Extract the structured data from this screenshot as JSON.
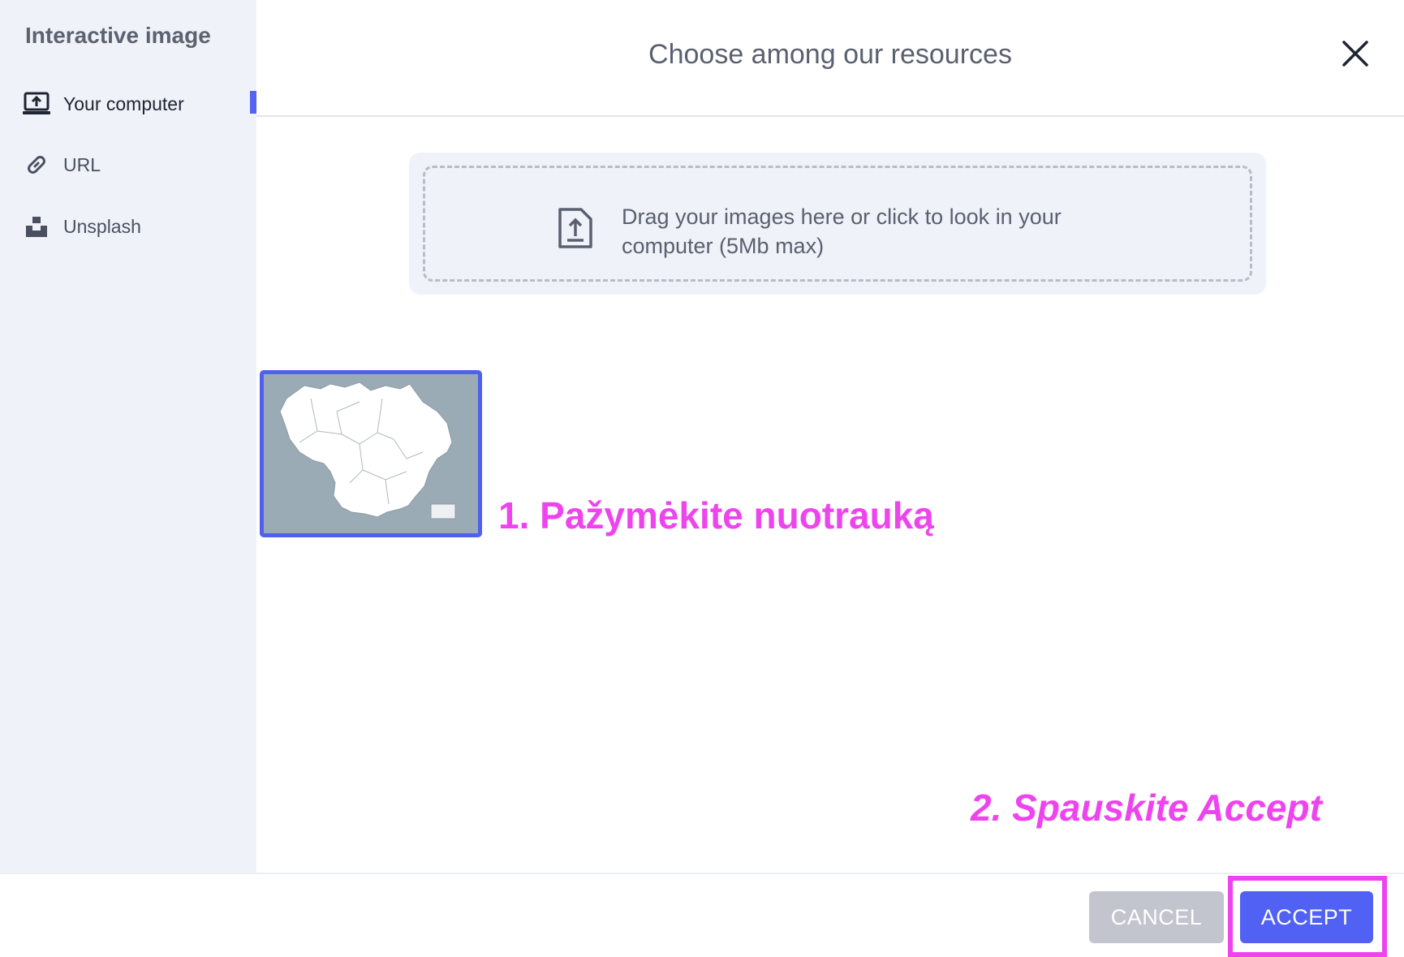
{
  "sidebar": {
    "title": "Interactive image",
    "items": [
      {
        "label": "Your computer",
        "icon": "upload-laptop-icon",
        "active": true
      },
      {
        "label": "URL",
        "icon": "link-icon",
        "active": false
      },
      {
        "label": "Unsplash",
        "icon": "unsplash-icon",
        "active": false
      }
    ]
  },
  "header": {
    "title": "Choose among our resources",
    "close_icon": "close-icon"
  },
  "dropzone": {
    "icon": "file-upload-icon",
    "text": "Drag your images here or click to look in your computer (5Mb max)"
  },
  "thumbnail": {
    "selected": true,
    "description_icon": "map-thumbnail"
  },
  "annotations": {
    "step1": "1. Pažymėkite nuotrauką",
    "step2": "2. Spauskite Accept"
  },
  "footer": {
    "cancel_label": "CANCEL",
    "accept_label": "ACCEPT"
  },
  "colors": {
    "accent": "#5161f3",
    "annotation": "#ee44ee",
    "sidebar_bg": "#eff2f9",
    "cancel_bg": "#c2c5cd"
  }
}
